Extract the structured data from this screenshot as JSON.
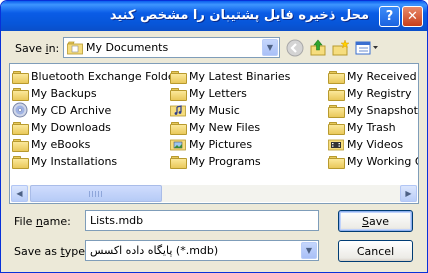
{
  "window": {
    "title": "محل ذخیره فایل پشتیبان را مشخص کنید",
    "help_icon": "?",
    "close_icon": "✕"
  },
  "savein": {
    "label_prefix": "Save ",
    "label_hot": "i",
    "label_suffix": "n:",
    "value": "My Documents"
  },
  "files": [
    {
      "name": "Bluetooth Exchange Folder",
      "icon": "folder-icon"
    },
    {
      "name": "My Backups",
      "icon": "folder-icon"
    },
    {
      "name": "My CD Archive",
      "icon": "cd-archive-icon"
    },
    {
      "name": "My Downloads",
      "icon": "folder-icon"
    },
    {
      "name": "My eBooks",
      "icon": "folder-icon"
    },
    {
      "name": "My Installations",
      "icon": "folder-icon"
    },
    {
      "name": "My Latest Binaries",
      "icon": "folder-icon"
    },
    {
      "name": "My Letters",
      "icon": "folder-icon"
    },
    {
      "name": "My Music",
      "icon": "music-folder-icon"
    },
    {
      "name": "My New Files",
      "icon": "folder-icon"
    },
    {
      "name": "My Pictures",
      "icon": "pictures-folder-icon"
    },
    {
      "name": "My Programs",
      "icon": "folder-icon"
    },
    {
      "name": "My Received Fi",
      "icon": "folder-icon"
    },
    {
      "name": "My Registry",
      "icon": "folder-icon"
    },
    {
      "name": "My Snapshots",
      "icon": "folder-icon"
    },
    {
      "name": "My Trash",
      "icon": "folder-icon"
    },
    {
      "name": "My Videos",
      "icon": "videos-folder-icon"
    },
    {
      "name": "My Working On",
      "icon": "folder-icon"
    }
  ],
  "filename": {
    "label_prefix": "File ",
    "label_hot": "n",
    "label_suffix": "ame:",
    "value": "Lists.mdb"
  },
  "savetype": {
    "label_prefix": "Save as ",
    "label_hot": "t",
    "label_suffix": "ype:",
    "value": "پایگاه داده اکسس (*.mdb)"
  },
  "buttons": {
    "save_hot": "S",
    "save_rest": "ave",
    "cancel": "Cancel"
  },
  "colors": {
    "titlebar": "#0a5ce6",
    "dialog_bg": "#ece9d8",
    "close_button": "#c73e1b"
  }
}
